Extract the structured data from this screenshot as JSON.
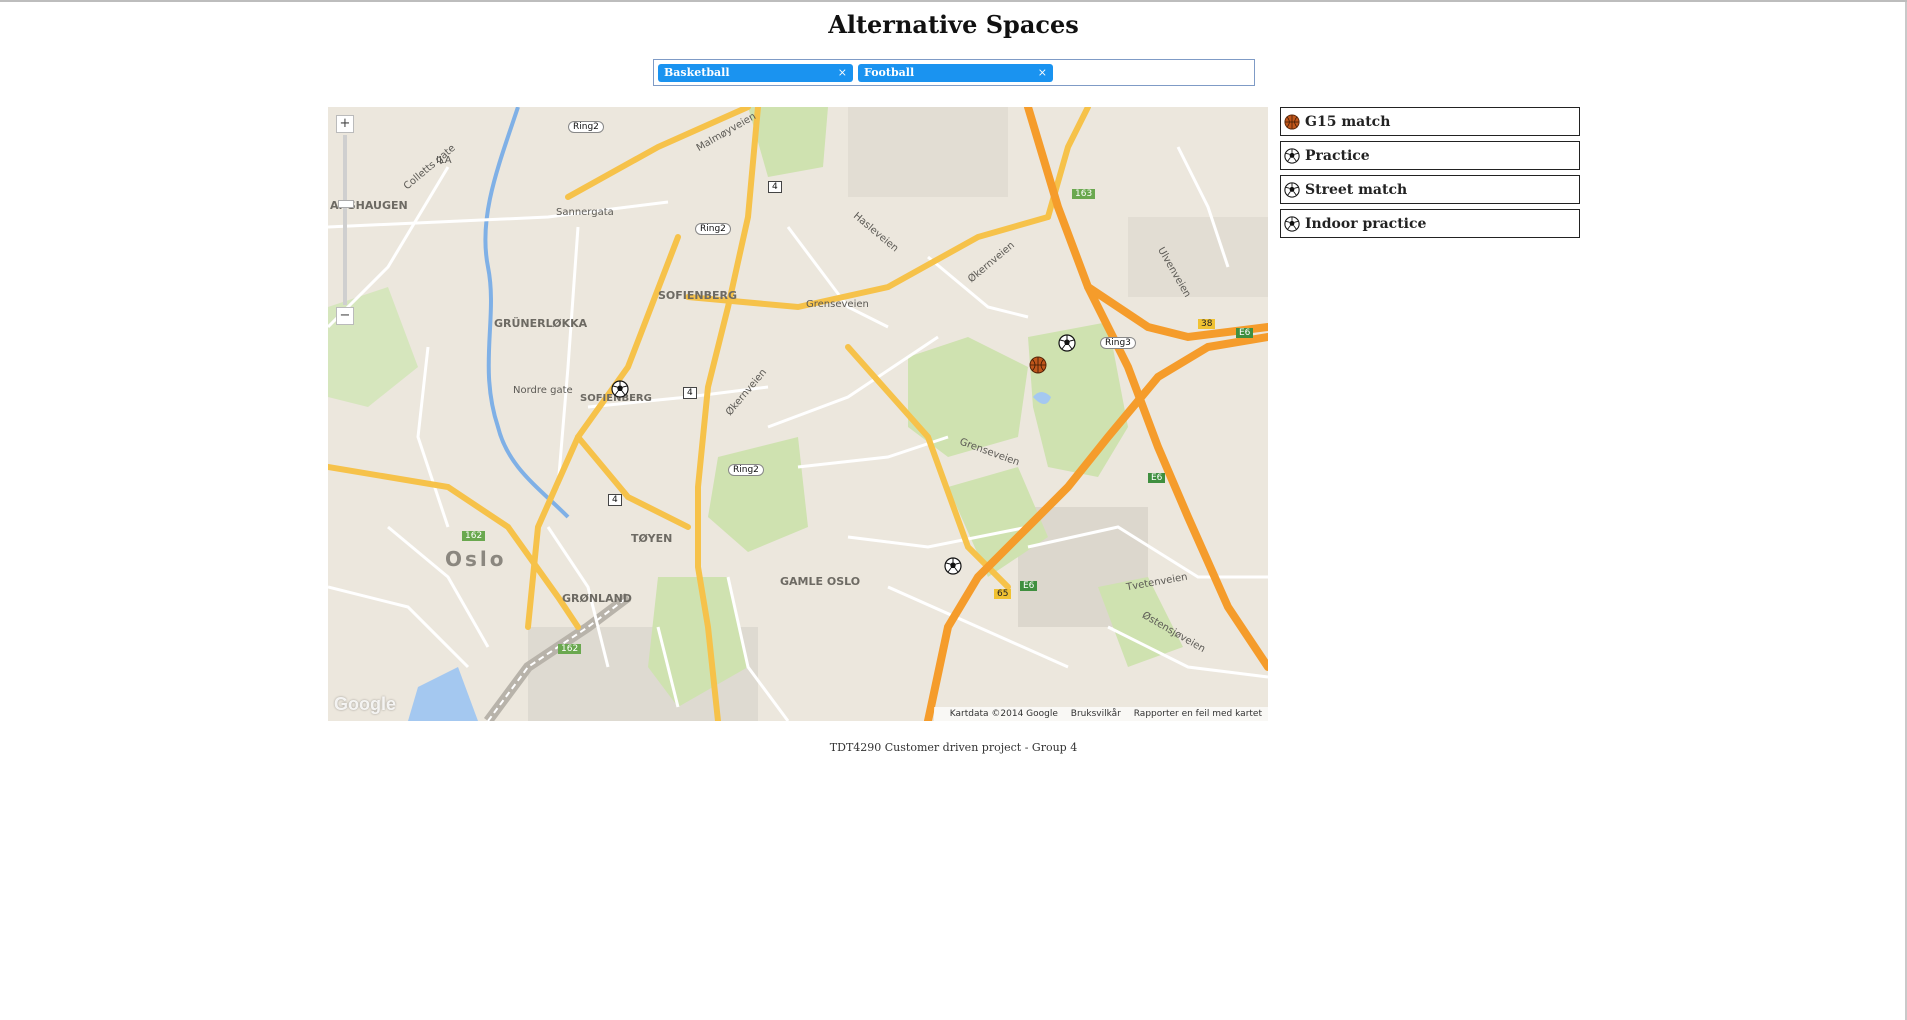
{
  "page": {
    "title": "Alternative Spaces"
  },
  "filter": {
    "tags": [
      {
        "label": "Basketball",
        "remove": "×"
      },
      {
        "label": "Football",
        "remove": "×"
      }
    ]
  },
  "map": {
    "zoom_in": "+",
    "zoom_out": "−",
    "logo": "Google",
    "attribution": [
      "Kartdata ©2014 Google",
      "Bruksvilkår",
      "Rapporter en feil med kartet"
    ],
    "labels": {
      "anshaugen": "ANSHAUGEN",
      "collettsgate": "Colletts gate",
      "sannergata": "Sannergata",
      "sofienberg": "SOFIENBERG",
      "grunerlokka": "GRÜNERLØKKA",
      "nordregate": "Nordre gate",
      "sofienberg2": "SOFIENBERG",
      "grenseveien": "Grenseveien",
      "okernveien": "Økernveien",
      "toyen": "TØYEN",
      "oslo": "Oslo",
      "gronland": "GRØNLAND",
      "gamleoslo": "GAMLE OSLO",
      "tvetenveien": "Tvetenveien",
      "ostensjoveien": "Østensjøveien",
      "ring2a": "Ring2",
      "ring2b": "Ring2",
      "ring2c": "Ring2",
      "ring3": "Ring3",
      "r4a": "4",
      "r4b": "4",
      "r4c": "4",
      "e6a": "E6",
      "e6b": "E6",
      "e6c": "E6",
      "r162a": "162",
      "r162b": "162",
      "r163": "163",
      "r65": "65",
      "r38": "38",
      "malmoyveien": "Malmøyveien",
      "hasleveien": "Hasleveien",
      "ulvenveien": "Ulvenveien",
      "grensevn2": "Grenseveien",
      "ila": "ILA"
    },
    "markers": [
      {
        "type": "football"
      },
      {
        "type": "basketball"
      },
      {
        "type": "football"
      },
      {
        "type": "football"
      }
    ]
  },
  "events": [
    {
      "name": "G15 match",
      "icon": "basketball"
    },
    {
      "name": "Practice",
      "icon": "football"
    },
    {
      "name": "Street match",
      "icon": "football"
    },
    {
      "name": "Indoor practice",
      "icon": "football"
    }
  ],
  "footer": {
    "text": "TDT4290 Customer driven project - Group 4"
  },
  "colors": {
    "tag": "#1a93f0",
    "map_bg": "#ece7dd",
    "park": "#cfe2b0",
    "major_road": "#f6c24a",
    "motorway": "#f59c2b",
    "water": "#a4c8f0"
  }
}
